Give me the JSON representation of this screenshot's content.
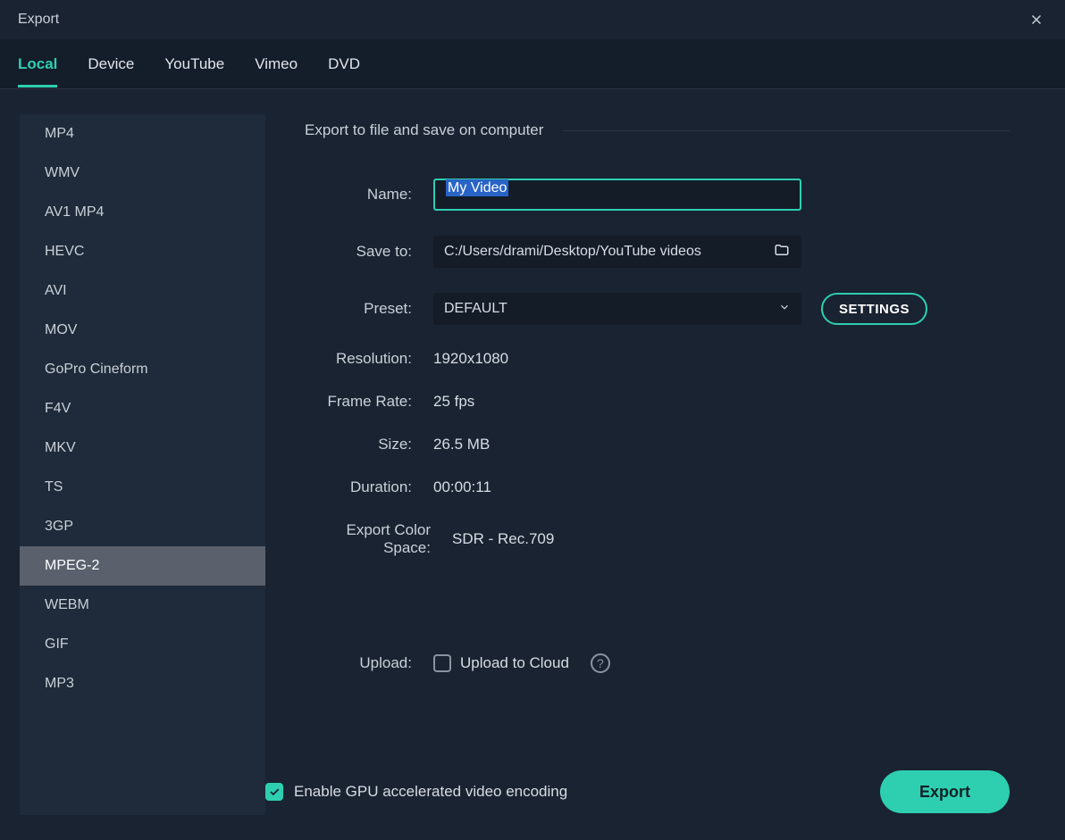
{
  "window": {
    "title": "Export"
  },
  "tabs": [
    {
      "label": "Local",
      "active": true
    },
    {
      "label": "Device",
      "active": false
    },
    {
      "label": "YouTube",
      "active": false
    },
    {
      "label": "Vimeo",
      "active": false
    },
    {
      "label": "DVD",
      "active": false
    }
  ],
  "formats": [
    {
      "label": "MP4",
      "active": false
    },
    {
      "label": "WMV",
      "active": false
    },
    {
      "label": "AV1 MP4",
      "active": false
    },
    {
      "label": "HEVC",
      "active": false
    },
    {
      "label": "AVI",
      "active": false
    },
    {
      "label": "MOV",
      "active": false
    },
    {
      "label": "GoPro Cineform",
      "active": false
    },
    {
      "label": "F4V",
      "active": false
    },
    {
      "label": "MKV",
      "active": false
    },
    {
      "label": "TS",
      "active": false
    },
    {
      "label": "3GP",
      "active": false
    },
    {
      "label": "MPEG-2",
      "active": true
    },
    {
      "label": "WEBM",
      "active": false
    },
    {
      "label": "GIF",
      "active": false
    },
    {
      "label": "MP3",
      "active": false
    }
  ],
  "section": {
    "title": "Export to file and save on computer"
  },
  "form": {
    "name_label": "Name:",
    "name_value": "My Video",
    "saveto_label": "Save to:",
    "saveto_value": "C:/Users/drami/Desktop/YouTube videos",
    "preset_label": "Preset:",
    "preset_value": "DEFAULT",
    "settings_button": "SETTINGS",
    "resolution_label": "Resolution:",
    "resolution_value": "1920x1080",
    "framerate_label": "Frame Rate:",
    "framerate_value": "25 fps",
    "size_label": "Size:",
    "size_value": "26.5 MB",
    "duration_label": "Duration:",
    "duration_value": "00:00:11",
    "colorspace_label": "Export Color Space:",
    "colorspace_value": "SDR - Rec.709",
    "upload_label": "Upload:",
    "upload_checkbox_label": "Upload to Cloud",
    "upload_checked": false
  },
  "footer": {
    "gpu_label": "Enable GPU accelerated video encoding",
    "gpu_checked": true,
    "export_button": "Export"
  }
}
